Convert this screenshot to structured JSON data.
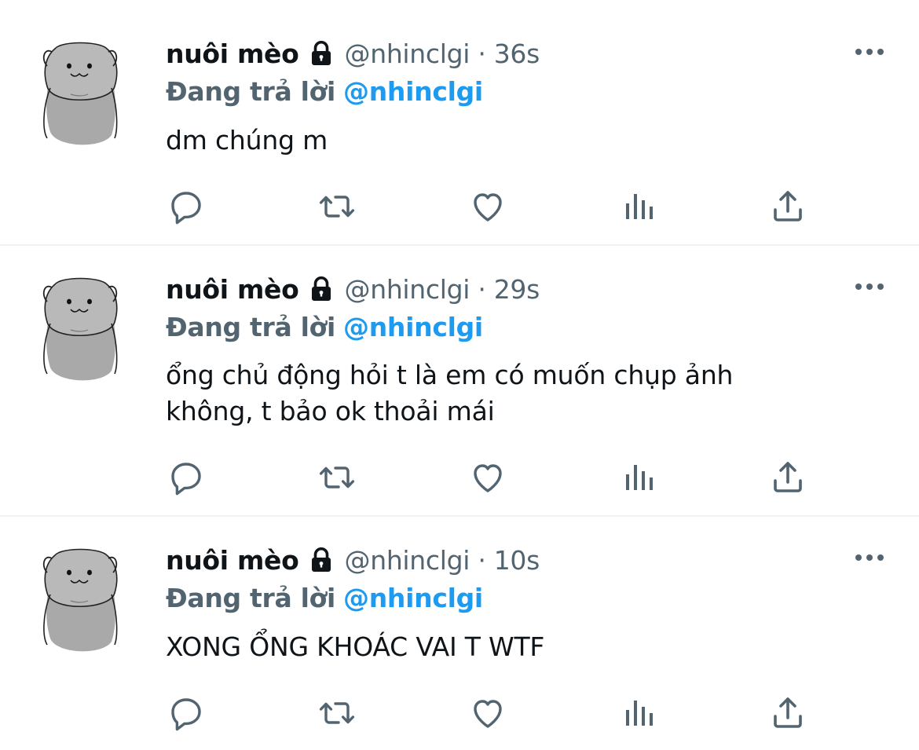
{
  "tweets": [
    {
      "display_name": "nuôi mèo",
      "handle_time": "@nhinclgi · 36s",
      "reply_prefix": "Đang trả lời",
      "reply_to": "@nhinclgi",
      "text": "dm chúng m"
    },
    {
      "display_name": "nuôi mèo",
      "handle_time": "@nhinclgi · 29s",
      "reply_prefix": "Đang trả lời",
      "reply_to": "@nhinclgi",
      "text_line1": "ổng chủ động hỏi t là em có muốn chụp ảnh",
      "text_line2": "không, t bảo ok thoải mái"
    },
    {
      "display_name": "nuôi mèo",
      "handle_time": "@nhinclgi · 10s",
      "reply_prefix": "Đang trả lời",
      "reply_to": "@nhinclgi",
      "text": "XONG ỔNG KHOÁC VAI T WTF"
    }
  ],
  "icons": {
    "lock": "lock-icon",
    "more": "more-icon",
    "reply": "reply-icon",
    "retweet": "retweet-icon",
    "like": "like-icon",
    "analytics": "analytics-icon",
    "share": "share-icon"
  },
  "colors": {
    "link": "#1d9bf0",
    "muted": "#536471",
    "text": "#0f1419",
    "divider": "#eff3f4"
  }
}
